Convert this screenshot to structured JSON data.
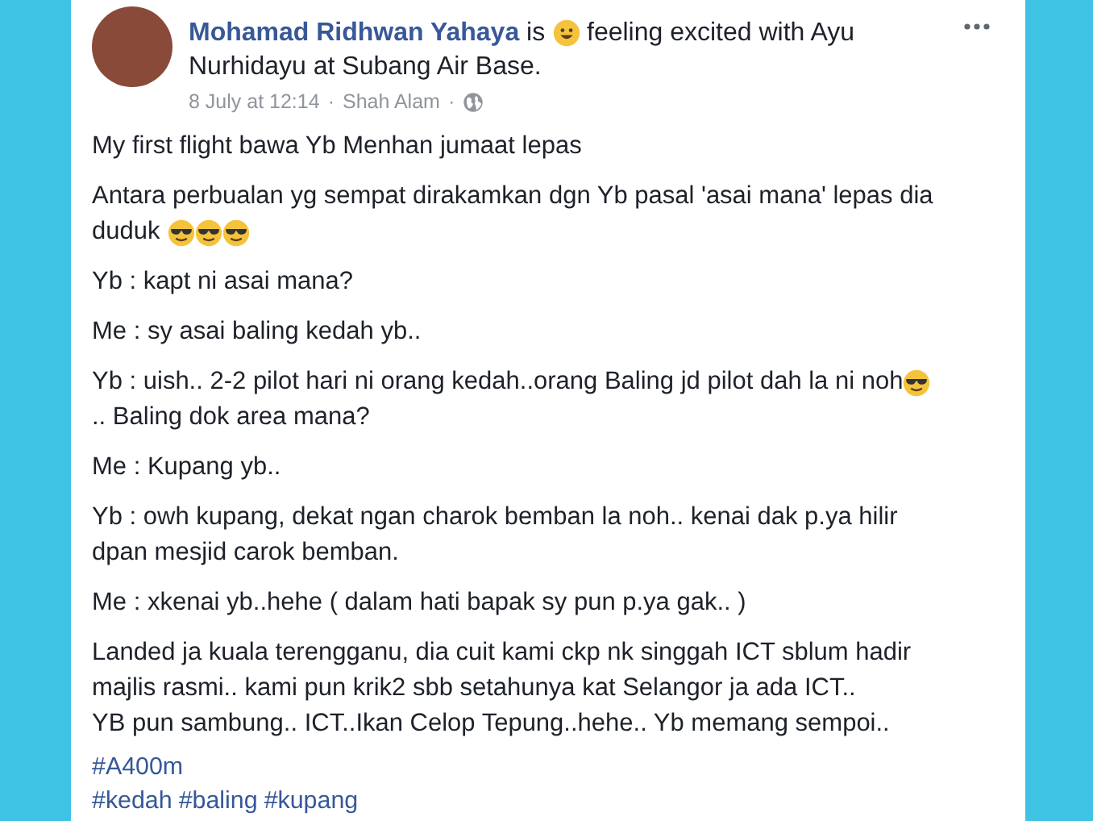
{
  "post": {
    "header": [
      [
        {
          "kind": "name",
          "text": "Mohamad Ridhwan Yahaya"
        },
        {
          "kind": "text",
          "text": " is "
        },
        {
          "kind": "smile_emoji"
        },
        {
          "kind": "text",
          "text": " feeling excited with Ayu"
        }
      ],
      [
        {
          "kind": "text",
          "text": "Nurhidayu at Subang Air Base."
        }
      ]
    ],
    "meta": {
      "time": "8 July at 12:14",
      "separator": "·",
      "place": "Shah Alam",
      "separator_2": "·"
    },
    "paragraphs": [
      [
        [
          {
            "kind": "text",
            "text": "My first flight bawa Yb Menhan jumaat lepas"
          }
        ]
      ],
      [
        [
          {
            "kind": "text",
            "text": "Antara perbualan yg sempat dirakamkan dgn Yb pasal 'asai mana' lepas dia"
          }
        ],
        [
          {
            "kind": "text",
            "text": "duduk "
          },
          {
            "kind": "cool_emoji"
          },
          {
            "kind": "cool_emoji"
          },
          {
            "kind": "cool_emoji"
          }
        ]
      ],
      [
        [
          {
            "kind": "text",
            "text": "Yb : kapt ni asai mana?"
          }
        ]
      ],
      [
        [
          {
            "kind": "text",
            "text": "Me : sy asai baling kedah yb.."
          }
        ]
      ],
      [
        [
          {
            "kind": "text",
            "text": "Yb : uish.. 2-2 pilot hari ni orang kedah..orang Baling jd pilot dah la ni noh"
          },
          {
            "kind": "cool_emoji"
          }
        ],
        [
          {
            "kind": "text",
            "text": ".. Baling dok area mana?"
          }
        ]
      ],
      [
        [
          {
            "kind": "text",
            "text": "Me : Kupang yb.."
          }
        ]
      ],
      [
        [
          {
            "kind": "text",
            "text": "Yb : owh kupang, dekat ngan charok bemban la noh.. kenai dak p.ya hilir"
          }
        ],
        [
          {
            "kind": "text",
            "text": "dpan mesjid carok bemban."
          }
        ]
      ],
      [
        [
          {
            "kind": "text",
            "text": "Me : xkenai yb..hehe ( dalam hati bapak sy pun p.ya gak.. )"
          }
        ]
      ],
      [
        [
          {
            "kind": "text",
            "text": "Landed ja kuala terengganu, dia cuit kami ckp nk singgah ICT sblum hadir"
          }
        ],
        [
          {
            "kind": "text",
            "text": "majlis rasmi.. kami pun krik2 sbb setahunya kat Selangor ja ada ICT.."
          }
        ],
        [
          {
            "kind": "text",
            "text": "YB pun sambung.. ICT..Ikan Celop Tepung..hehe.. Yb memang sempoi.."
          }
        ]
      ]
    ],
    "hashtag_lines": [
      [
        "#A400m"
      ],
      [
        "#kedah",
        "#baling",
        "#kupang"
      ]
    ]
  }
}
